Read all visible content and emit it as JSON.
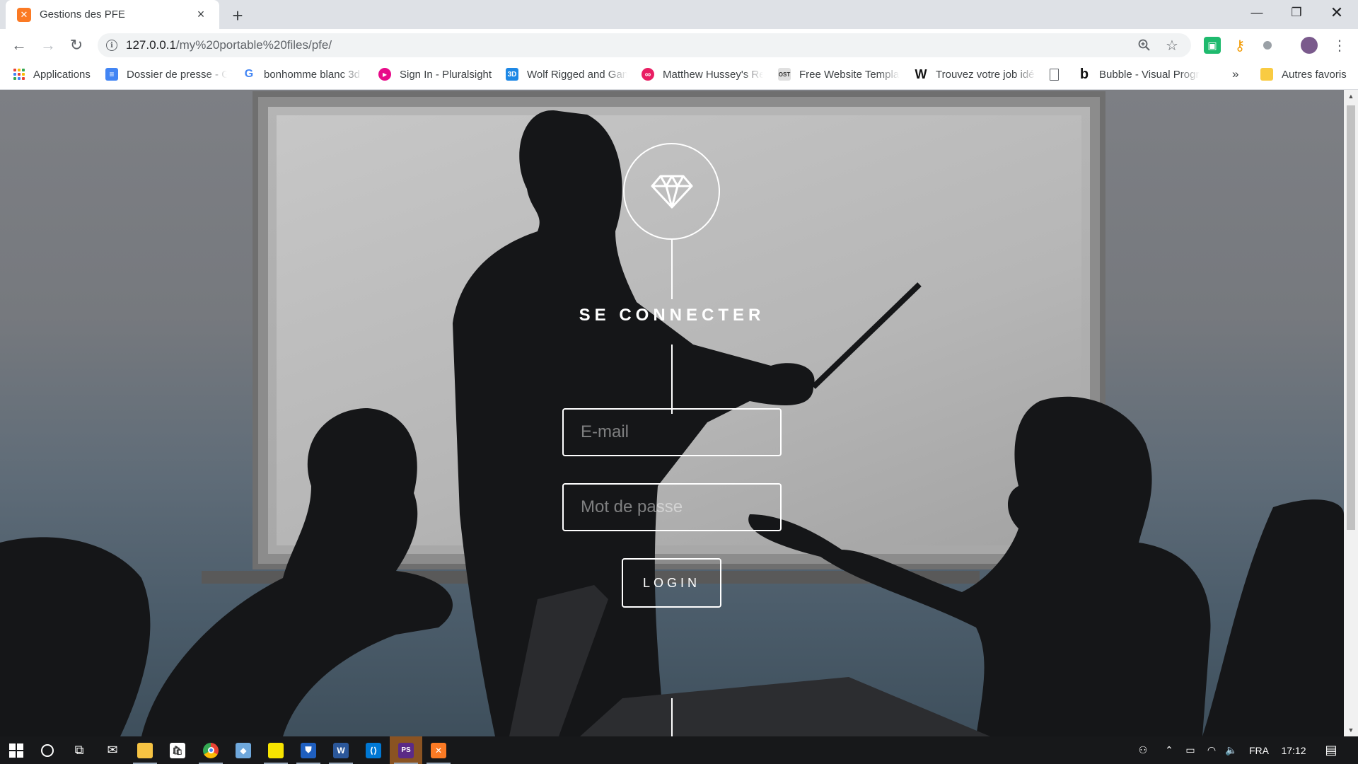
{
  "browser": {
    "tab_title": "Gestions des PFE",
    "tab_favicon": "xampp-icon",
    "new_tab_symbol": "+",
    "url_host": "127.0.0.1",
    "url_path": "/my%20portable%20files/pfe/"
  },
  "bookmarks": [
    {
      "label": "Applications",
      "icon": "apps-grid-icon"
    },
    {
      "label": "Dossier de presse - G",
      "icon": "google-docs-icon"
    },
    {
      "label": "bonhomme blanc 3d",
      "icon": "google-icon"
    },
    {
      "label": "Sign In - Pluralsight",
      "icon": "pluralsight-icon"
    },
    {
      "label": "Wolf Rigged and Gan",
      "icon": "3d-icon"
    },
    {
      "label": "Matthew Hussey's Re",
      "icon": "link-icon"
    },
    {
      "label": "Free Website Templat",
      "icon": "ost-icon"
    },
    {
      "label": "Trouvez votre job idé",
      "icon": "w-icon"
    },
    {
      "label": "",
      "icon": "page-icon"
    },
    {
      "label": "Bubble - Visual Progr",
      "icon": "bubble-icon"
    }
  ],
  "bookmarks_overflow": "»",
  "other_bookmarks": "Autres favoris",
  "login": {
    "title": "SE CONNECTER",
    "email_placeholder": "E-mail",
    "password_placeholder": "Mot de passe",
    "button_label": "LOGIN"
  },
  "taskbar": {
    "language": "FRA",
    "time": "17:12"
  },
  "colors": {
    "accent_orange": "#fb7a24",
    "chrome_tabstrip": "#dee1e6",
    "taskbar": "#17181a"
  }
}
